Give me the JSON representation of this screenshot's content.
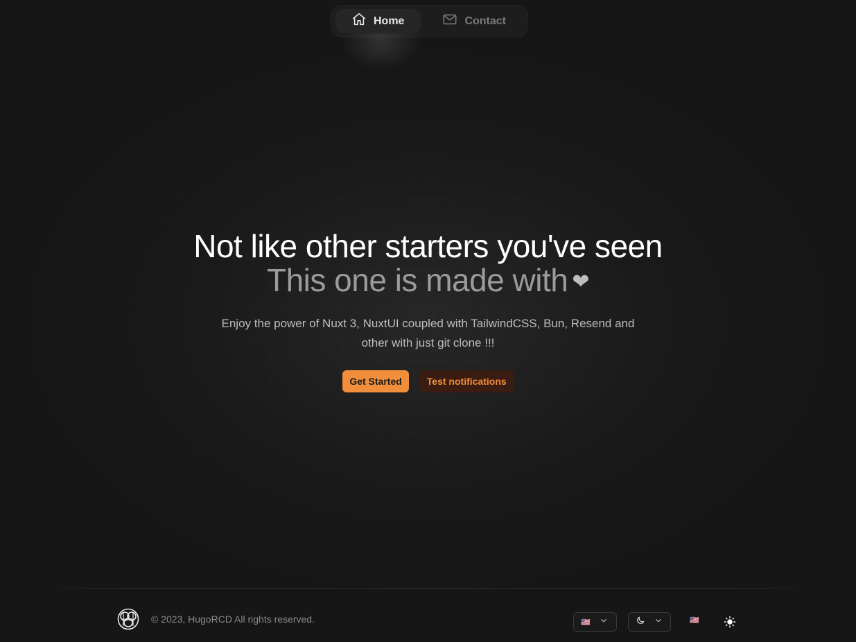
{
  "nav": {
    "items": [
      {
        "label": "Home",
        "icon": "home-icon",
        "active": true
      },
      {
        "label": "Contact",
        "icon": "mail-icon",
        "active": false
      }
    ]
  },
  "hero": {
    "title_line1": "Not like other starters you've seen",
    "title_line2": "This one is made with",
    "heart": "❤",
    "description": "Enjoy the power of Nuxt 3, NuxtUI coupled with TailwindCSS, Bun, Resend and other with just git clone !!!",
    "primary_button": "Get Started",
    "secondary_button": "Test notifications"
  },
  "footer": {
    "copyright": "© 2023, HugoRCD All rights reserved.",
    "language_flag": "🇺🇸",
    "theme_icon": "moon-icon",
    "flag_button": "🇺🇸",
    "color_mode_icon": "sun-icon"
  },
  "colors": {
    "accent": "#f18e3b",
    "accent_soft_bg": "#3a1c12",
    "background": "#141414"
  }
}
